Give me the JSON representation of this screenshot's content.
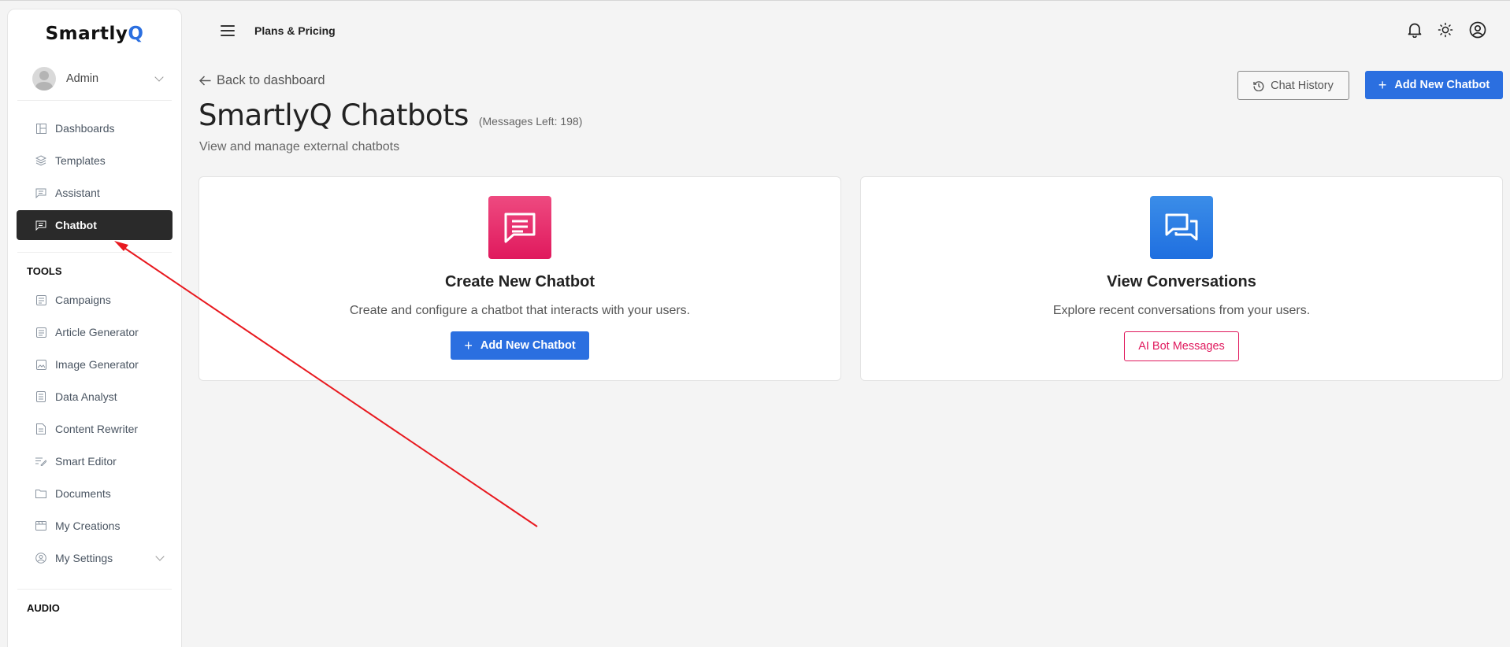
{
  "brand": {
    "logo_main": "Smartly",
    "logo_q": "Q"
  },
  "user": {
    "name": "Admin"
  },
  "sidebar": {
    "items": [
      {
        "label": "Dashboards",
        "icon": "dashboard-icon"
      },
      {
        "label": "Templates",
        "icon": "layers-icon"
      },
      {
        "label": "Assistant",
        "icon": "message-icon"
      },
      {
        "label": "Chatbot",
        "icon": "chat-icon",
        "active": true
      }
    ],
    "tools_title": "TOOLS",
    "tools": [
      {
        "label": "Campaigns",
        "icon": "campaign-icon"
      },
      {
        "label": "Article Generator",
        "icon": "article-icon"
      },
      {
        "label": "Image Generator",
        "icon": "image-icon"
      },
      {
        "label": "Data Analyst",
        "icon": "data-icon"
      },
      {
        "label": "Content Rewriter",
        "icon": "rewrite-icon"
      },
      {
        "label": "Smart Editor",
        "icon": "editor-icon"
      },
      {
        "label": "Documents",
        "icon": "folder-icon"
      },
      {
        "label": "My Creations",
        "icon": "creations-icon"
      },
      {
        "label": "My Settings",
        "icon": "settings-icon"
      }
    ],
    "audio_title": "AUDIO"
  },
  "topbar": {
    "title": "Plans & Pricing"
  },
  "main": {
    "back_label": "Back to dashboard",
    "title": "SmartlyQ Chatbots",
    "messages_left": "(Messages Left: 198)",
    "subtitle": "View and manage external chatbots",
    "chat_history_label": "Chat History",
    "add_new_label": "Add New Chatbot",
    "plus": "+"
  },
  "cards": [
    {
      "title": "Create New Chatbot",
      "desc": "Create and configure a chatbot that interacts with your users.",
      "button": "Add New Chatbot"
    },
    {
      "title": "View Conversations",
      "desc": "Explore recent conversations from your users.",
      "button": "AI Bot Messages"
    }
  ],
  "colors": {
    "primary": "#2b6fe0",
    "accent_pink": "#e0195d",
    "sidebar_active": "#2a2a2a",
    "annotation_arrow": "#e8191f"
  }
}
